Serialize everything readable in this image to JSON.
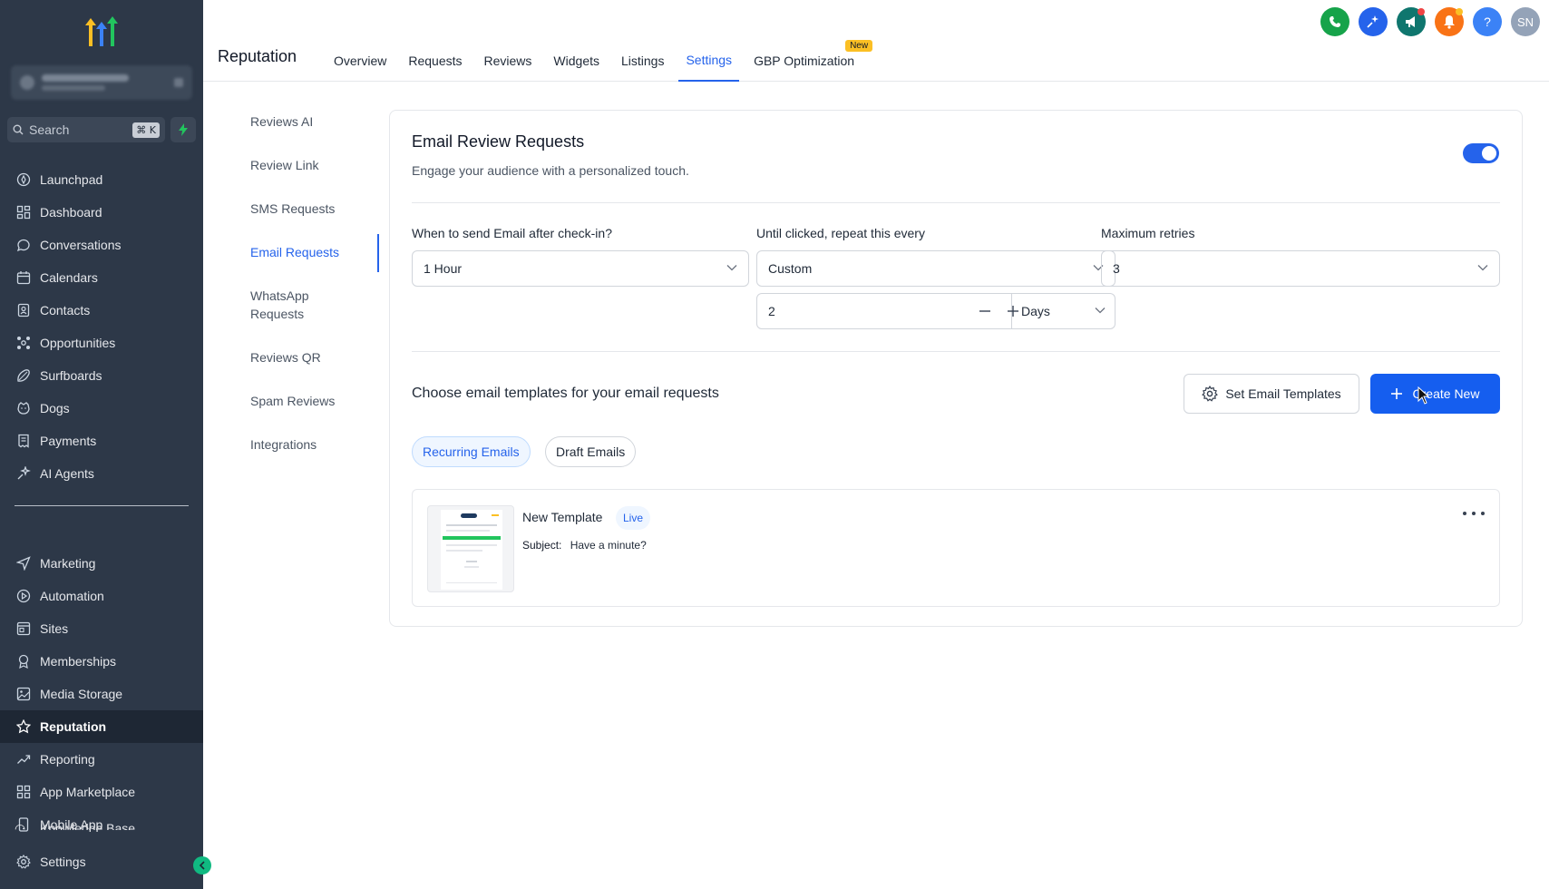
{
  "sidebar": {
    "search_placeholder": "Search",
    "search_shortcut": "⌘ K",
    "nav_main": [
      {
        "label": "Launchpad",
        "icon": "launchpad-icon"
      },
      {
        "label": "Dashboard",
        "icon": "dashboard-icon"
      },
      {
        "label": "Conversations",
        "icon": "chat-icon"
      },
      {
        "label": "Calendars",
        "icon": "calendar-icon"
      },
      {
        "label": "Contacts",
        "icon": "contacts-icon"
      },
      {
        "label": "Opportunities",
        "icon": "opportunities-icon"
      },
      {
        "label": "Surfboards",
        "icon": "surfboard-icon"
      },
      {
        "label": "Dogs",
        "icon": "dog-icon"
      },
      {
        "label": "Payments",
        "icon": "payments-icon"
      },
      {
        "label": "AI Agents",
        "icon": "ai-agents-icon"
      }
    ],
    "nav_secondary": [
      {
        "label": "Marketing",
        "icon": "send-icon"
      },
      {
        "label": "Automation",
        "icon": "automation-icon"
      },
      {
        "label": "Sites",
        "icon": "sites-icon"
      },
      {
        "label": "Memberships",
        "icon": "membership-icon"
      },
      {
        "label": "Media Storage",
        "icon": "media-icon"
      },
      {
        "label": "Reputation",
        "icon": "star-icon",
        "active": true
      },
      {
        "label": "Reporting",
        "icon": "reporting-icon"
      },
      {
        "label": "App Marketplace",
        "icon": "marketplace-icon"
      },
      {
        "label": "Mobile App",
        "icon": "mobile-icon"
      }
    ],
    "partial_item": "Knowledge Base",
    "settings_label": "Settings"
  },
  "header": {
    "app_title": "Reputation",
    "tabs": [
      {
        "label": "Overview"
      },
      {
        "label": "Requests"
      },
      {
        "label": "Reviews"
      },
      {
        "label": "Widgets"
      },
      {
        "label": "Listings"
      },
      {
        "label": "Settings",
        "active": true
      },
      {
        "label": "GBP Optimization",
        "badge": "New"
      }
    ],
    "avatar_initials": "SN",
    "help_glyph": "?"
  },
  "subnav": [
    {
      "label": "Reviews AI"
    },
    {
      "label": "Review Link"
    },
    {
      "label": "SMS Requests"
    },
    {
      "label": "Email Requests",
      "active": true
    },
    {
      "label": "WhatsApp Requests"
    },
    {
      "label": "Reviews QR"
    },
    {
      "label": "Spam Reviews"
    },
    {
      "label": "Integrations"
    }
  ],
  "card": {
    "title": "Email Review Requests",
    "subtitle": "Engage your audience with a personalized touch.",
    "enabled": true,
    "when_label": "When to send Email after check-in?",
    "when_value": "1 Hour",
    "repeat_label": "Until clicked, repeat this every",
    "repeat_value": "Custom",
    "retries_label": "Maximum retries",
    "retries_value": "3",
    "interval_value": "2",
    "interval_unit": "Days",
    "templates_title": "Choose email templates for your email requests",
    "set_templates_label": "Set Email Templates",
    "create_new_label": "Create New",
    "filter_tabs": [
      {
        "label": "Recurring Emails",
        "active": true
      },
      {
        "label": "Draft Emails"
      }
    ],
    "template": {
      "name": "New Template",
      "status": "Live",
      "subject_label": "Subject:",
      "subject_value": "Have a minute?"
    }
  },
  "colors": {
    "sidebar_bg": "#2d3848",
    "accent": "#2563eb",
    "primary_button": "#155eef",
    "phone_icon": "#16a34a",
    "notification": "#f97316"
  }
}
